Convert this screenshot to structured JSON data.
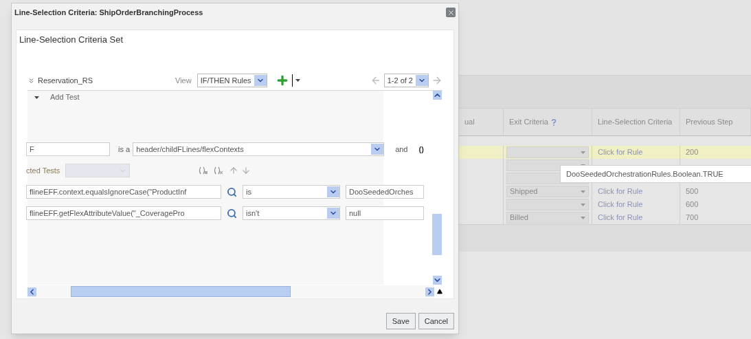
{
  "background_table": {
    "columns": [
      "ual",
      "Exit Criteria",
      "Line-Selection Criteria",
      "Previous Step"
    ],
    "rows": [
      {
        "exit": "",
        "rule": "Click for Rule",
        "step": "200",
        "selected": true
      },
      {
        "exit": "",
        "rule": "",
        "step": "",
        "selected": false
      },
      {
        "exit": "",
        "rule": "",
        "step": "",
        "selected": false
      },
      {
        "exit": "Shipped",
        "rule": "Click for Rule",
        "step": "500",
        "selected": false
      },
      {
        "exit": "",
        "rule": "Click for Rule",
        "step": "600",
        "selected": false
      },
      {
        "exit": "Billed",
        "rule": "Click for Rule",
        "step": "700",
        "selected": false
      }
    ]
  },
  "tooltip": "DooSeededOrchestrationRules.Boolean.TRUE",
  "dialog": {
    "title": "Line-Selection Criteria: ShipOrderBranchingProcess",
    "panel_title": "Line-Selection Criteria Set",
    "ruleset": "Reservation_RS",
    "view_label": "View",
    "view_value": "IF/THEN Rules",
    "pager": "1-2 of 2",
    "section": "Add Test",
    "fact": {
      "value": "F",
      "is_a": "is a",
      "type": "header/childFLines/flexContexts",
      "and": "and",
      "paren": "()"
    },
    "selected_tests_label": "cted Tests",
    "tests": [
      {
        "left": "flineEFF.context.equalsIgnoreCase(\"ProductInf",
        "op": "is",
        "right": "DooSeededOrches"
      },
      {
        "left": "flineEFF.getFlexAttributeValue(\"_CoveragePro",
        "op": "isn't",
        "right": "null"
      }
    ],
    "buttons": [
      "Save",
      "Cancel"
    ]
  }
}
